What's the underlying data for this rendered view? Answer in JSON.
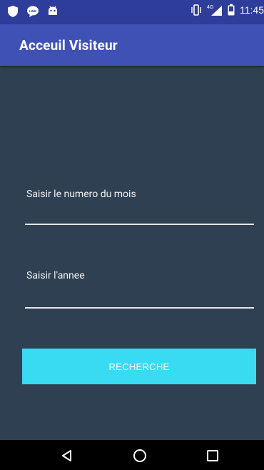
{
  "status_bar": {
    "time": "11:45",
    "network": "4G",
    "icons": [
      "shield-icon",
      "line-chat-icon",
      "android-bot-icon",
      "vibrate-icon",
      "signal-icon",
      "battery-icon"
    ]
  },
  "app_bar": {
    "title": "Acceuil Visiteur"
  },
  "form": {
    "month_label": "Saisir le numero du mois",
    "month_value": "",
    "year_label": "Saisir l'annee",
    "year_value": "",
    "search_button_label": "RECHERCHE"
  },
  "nav_bar": {
    "icons": [
      "back-icon",
      "home-icon",
      "recents-icon"
    ]
  },
  "colors": {
    "status_bar": "#2e3d9a",
    "app_bar": "#3f51b5",
    "background": "#2f4052",
    "button": "#39dbf3",
    "nav_bar": "#000000"
  }
}
